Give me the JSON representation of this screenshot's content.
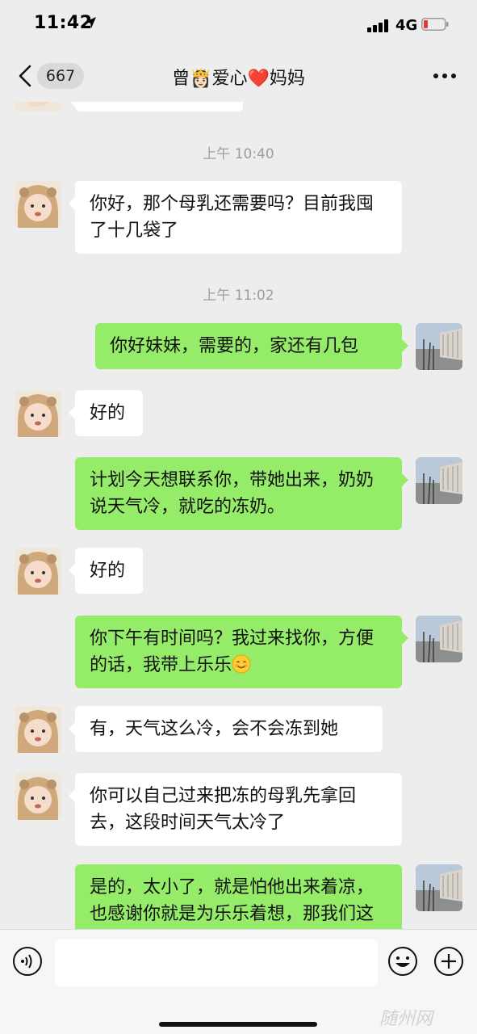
{
  "status_bar": {
    "time": "11:42",
    "network": "4G"
  },
  "nav": {
    "back_count": "667",
    "title": "曾👸🏻爱心❤️妈妈"
  },
  "chat": {
    "timestamps": [
      "上午 10:40",
      "上午 11:02"
    ],
    "messages": [
      {
        "side": "in",
        "text": "你好，那个母乳还需要吗？目前我囤了十几袋了"
      },
      {
        "side": "out",
        "text": "你好妹妹，需要的，家还有几包"
      },
      {
        "side": "in",
        "text": "好的"
      },
      {
        "side": "out",
        "text": "计划今天想联系你，带她出来，奶奶说天气冷，就吃的冻奶。"
      },
      {
        "side": "in",
        "text": "好的"
      },
      {
        "side": "out",
        "text": "你下午有时间吗？我过来找你，方便的话，我带上乐乐",
        "emoji": "smile-emoji"
      },
      {
        "side": "in",
        "text": "有，天气这么冷，会不会冻到她"
      },
      {
        "side": "in",
        "text": "你可以自己过来把冻的母乳先拿回去，这段时间天气太冷了"
      },
      {
        "side": "out",
        "text": "是的，太小了，就是怕他出来着凉，也感谢你就是为乐乐着想，那我们这样子这两年呢和他时候我再"
      }
    ]
  },
  "input_bar": {
    "placeholder": "",
    "icons": [
      "voice-icon",
      "smile-icon",
      "plus-icon"
    ]
  },
  "watermark": "随州网",
  "colors": {
    "background": "#ededed",
    "outgoing_bubble": "#95ec69",
    "incoming_bubble": "#ffffff",
    "battery_low": "#e53935"
  }
}
